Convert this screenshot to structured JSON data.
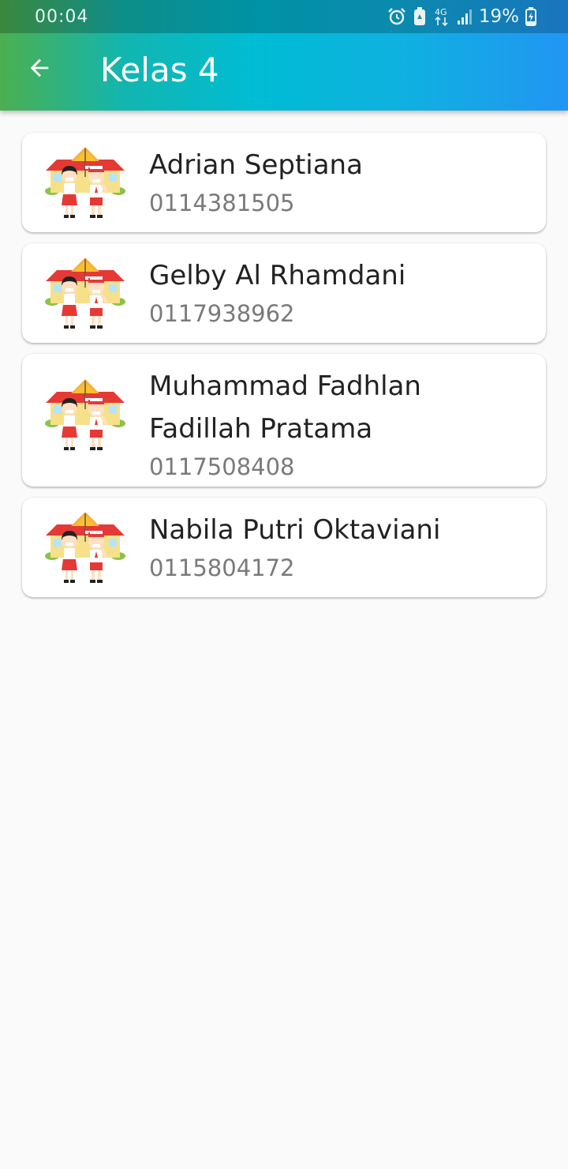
{
  "status_bar": {
    "time": "00:04",
    "network": "4G",
    "battery_percent": "19%",
    "icons": [
      "alarm-icon",
      "battery-saver-icon",
      "network-4g-icon",
      "signal-icon",
      "battery-charging-icon"
    ]
  },
  "app_bar": {
    "title": "Kelas 4",
    "back_icon": "arrow-left-icon"
  },
  "students": [
    {
      "name": "Adrian Septiana",
      "nisn": "0114381505"
    },
    {
      "name": "Gelby Al Rhamdani",
      "nisn": "0117938962"
    },
    {
      "name": "Muhammad Fadhlan Fadillah Pratama",
      "nisn": "0117508408"
    },
    {
      "name": "Nabila Putri Oktaviani",
      "nisn": "0115804172"
    }
  ],
  "colors": {
    "gradient_start": "#4caf50",
    "gradient_mid": "#00bcd4",
    "gradient_end": "#2196f3",
    "background": "#fafafa",
    "card": "#ffffff"
  }
}
